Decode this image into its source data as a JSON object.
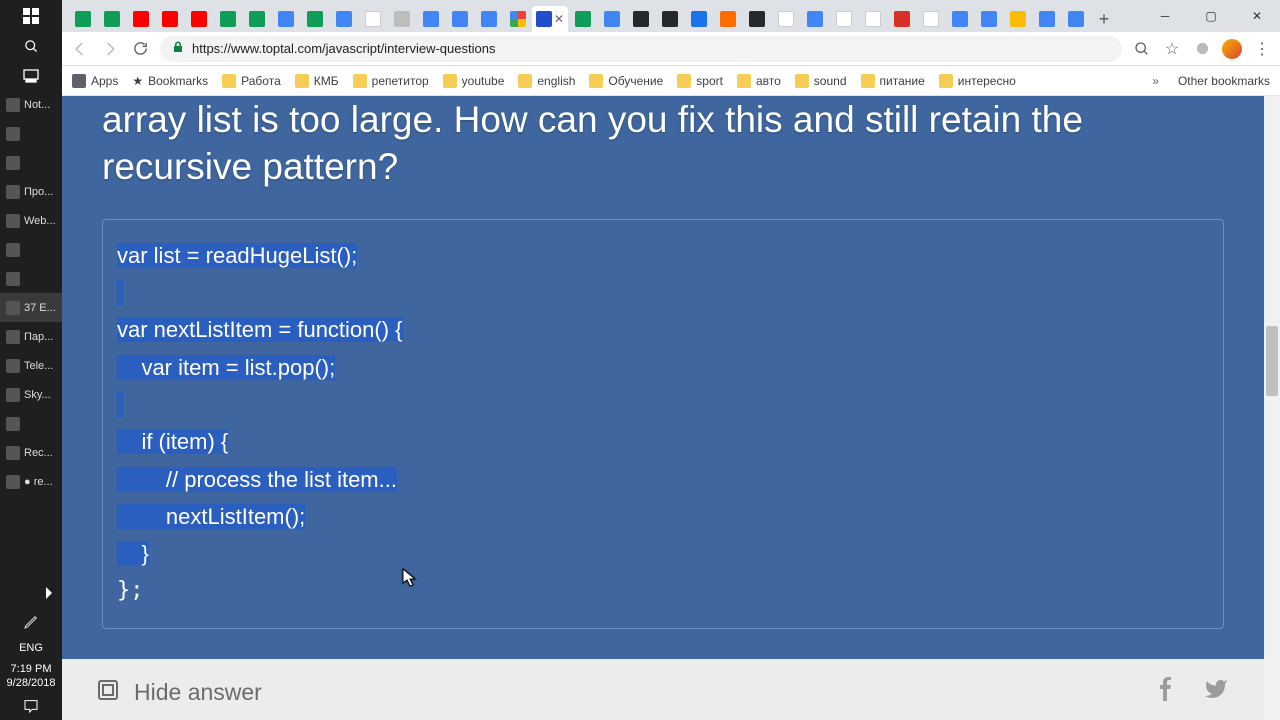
{
  "taskbar": {
    "items": [
      {
        "label": "Not..."
      },
      {
        "label": ""
      },
      {
        "label": ""
      },
      {
        "label": "Про..."
      },
      {
        "label": "Web..."
      },
      {
        "label": ""
      },
      {
        "label": ""
      },
      {
        "label": "37 E..."
      },
      {
        "label": "Пар..."
      },
      {
        "label": "Tele..."
      },
      {
        "label": "Sky..."
      },
      {
        "label": ""
      },
      {
        "label": "Rec..."
      },
      {
        "label": "● re..."
      }
    ],
    "lang": "ENG",
    "time": "7:19 PM",
    "date": "9/28/2018"
  },
  "browser": {
    "url": "https://www.toptal.com/javascript/interview-questions",
    "tabs_fav": [
      "g-sheets",
      "g-sheets",
      "yt",
      "yt",
      "yt",
      "g-sheets",
      "g-sheets",
      "g-docs",
      "g-sheets",
      "g-docs",
      "white",
      "generic",
      "g-docs",
      "g-docs",
      "g-docs",
      "google",
      "toptal",
      "g-sheets",
      "g-docs",
      "gh",
      "gh",
      "blue",
      "orange",
      "gh",
      "white",
      "g-docs",
      "white",
      "white",
      "red",
      "white",
      "g-docs",
      "g-docs",
      "drive",
      "g-docs",
      "g-docs"
    ],
    "active_tab_index": 16,
    "bookmarks_label": "Bookmarks",
    "apps_label": "Apps",
    "bookmarks": [
      "Работа",
      "КМБ",
      "репетитор",
      "youtube",
      "english",
      "Обучение",
      "sport",
      "авто",
      "sound",
      "питание",
      "интересно"
    ],
    "other_bookmarks": "Other bookmarks"
  },
  "content": {
    "question": "array list is too large. How can you fix this and still retain the recursive pattern?",
    "code_lines": [
      "var list = readHugeList();",
      "",
      "var nextListItem = function() {",
      "    var item = list.pop();",
      "",
      "    if (item) {",
      "        // process the list item...",
      "        nextListItem();",
      "    }",
      "};"
    ],
    "hide_answer": "Hide answer"
  }
}
